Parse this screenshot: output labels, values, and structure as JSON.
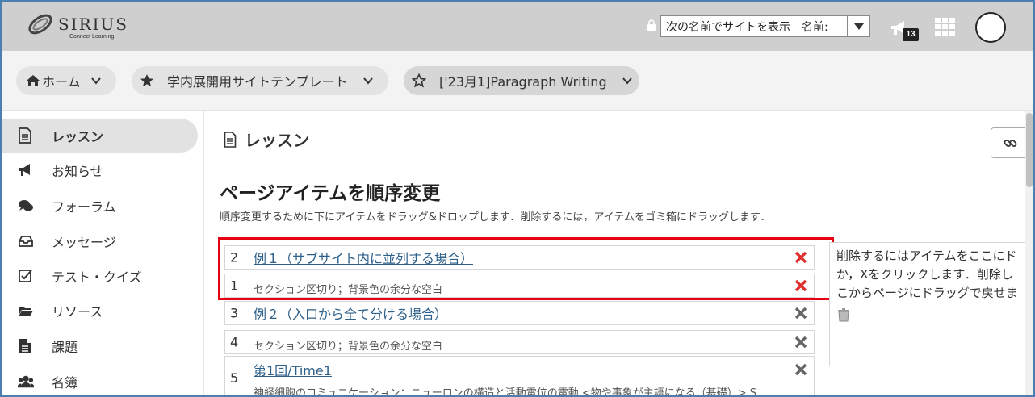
{
  "header": {
    "logo_text": "SIRIUS",
    "logo_tagline": "Connect Learning.",
    "view_as_label": "次の名前でサイトを表示",
    "view_as_name": "名前:",
    "notification_count": "13"
  },
  "breadcrumbs": {
    "home": "ホーム",
    "site": "学内展開用サイトテンプレート",
    "course": "['23月1]Paragraph Writing"
  },
  "sidebar": {
    "items": [
      {
        "label": "レッスン",
        "icon": "document-icon"
      },
      {
        "label": "お知らせ",
        "icon": "megaphone-icon"
      },
      {
        "label": "フォーラム",
        "icon": "comments-icon"
      },
      {
        "label": "メッセージ",
        "icon": "inbox-icon"
      },
      {
        "label": "テスト・クイズ",
        "icon": "checkbox-icon"
      },
      {
        "label": "リソース",
        "icon": "folder-open-icon"
      },
      {
        "label": "課題",
        "icon": "file-icon"
      },
      {
        "label": "名簿",
        "icon": "users-icon"
      }
    ]
  },
  "main": {
    "page_title": "レッスン",
    "section_title": "ページアイテムを順序変更",
    "instruction": "順序変更するために下にアイテムをドラッグ&ドロップします．削除するには，アイテムをゴミ箱にドラッグします．",
    "items": [
      {
        "num": "2",
        "title": "例１（サブサイト内に並列する場合）"
      },
      {
        "num": "1",
        "text": "セクション区切り；背景色の余分な空白"
      },
      {
        "num": "3",
        "title": "例２（入口から全て分ける場合）"
      },
      {
        "num": "4",
        "text": "セクション区切り；背景色の余分な空白"
      },
      {
        "num": "5",
        "title": "第1回/Time1",
        "desc": "神経細胞のコミュニケーション：ニューロンの構造と活動電位の電動 <物や事象が主語になる（基礎）> S..."
      }
    ],
    "trash_text": [
      "削除するにはアイテムをここにド",
      "か，Xをクリックします．削除し",
      "こからページにドラッグで戻せま"
    ]
  },
  "colors": {
    "highlight": "#e60012",
    "delete_red": "#e03030",
    "delete_gray": "#666666",
    "link": "#2c5f8a"
  }
}
